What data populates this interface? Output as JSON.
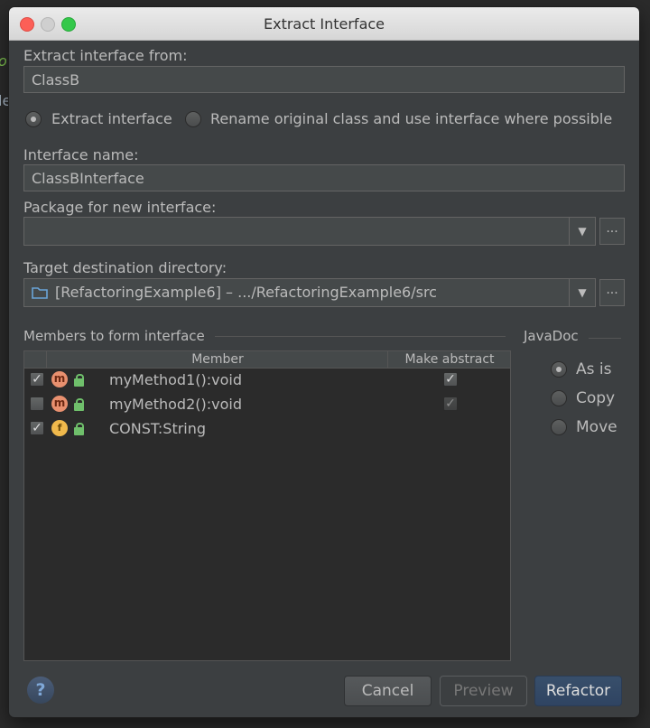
{
  "window": {
    "title": "Extract Interface"
  },
  "extract_from": {
    "label": "Extract interface from:",
    "value": "ClassB"
  },
  "mode": {
    "options": [
      "Extract interface",
      "Rename original class and use interface where possible"
    ],
    "selected": "Extract interface"
  },
  "interface_name": {
    "label": "Interface name:",
    "value": "ClassBInterface"
  },
  "package": {
    "label": "Package for new interface:",
    "value": "",
    "browse": "..."
  },
  "target": {
    "label": "Target destination directory:",
    "value": "[RefactoringExample6] – .../RefactoringExample6/src",
    "browse": "..."
  },
  "members": {
    "title": "Members to form interface",
    "columns": [
      "Member",
      "Make abstract"
    ],
    "rows": [
      {
        "checked": true,
        "icon": "method-icon",
        "icon_letter": "m",
        "name": "myMethod1():void",
        "abstract": true
      },
      {
        "checked": false,
        "icon": "method-icon",
        "icon_letter": "m",
        "name": "myMethod2():void",
        "abstract": true
      },
      {
        "checked": true,
        "icon": "field-icon",
        "icon_letter": "f",
        "name": "CONST:String",
        "abstract": null
      }
    ]
  },
  "javadoc": {
    "title": "JavaDoc",
    "options": [
      "As is",
      "Copy",
      "Move"
    ],
    "selected": "As is"
  },
  "buttons": {
    "help": "?",
    "cancel": "Cancel",
    "preview": "Preview",
    "refactor": "Refactor"
  },
  "colors": {
    "dialog_bg": "#3c3f41",
    "field_bg": "#45494a",
    "primary_button": "#2f4462",
    "method_icon": "#e8906f",
    "field_icon": "#f0b94c"
  }
}
